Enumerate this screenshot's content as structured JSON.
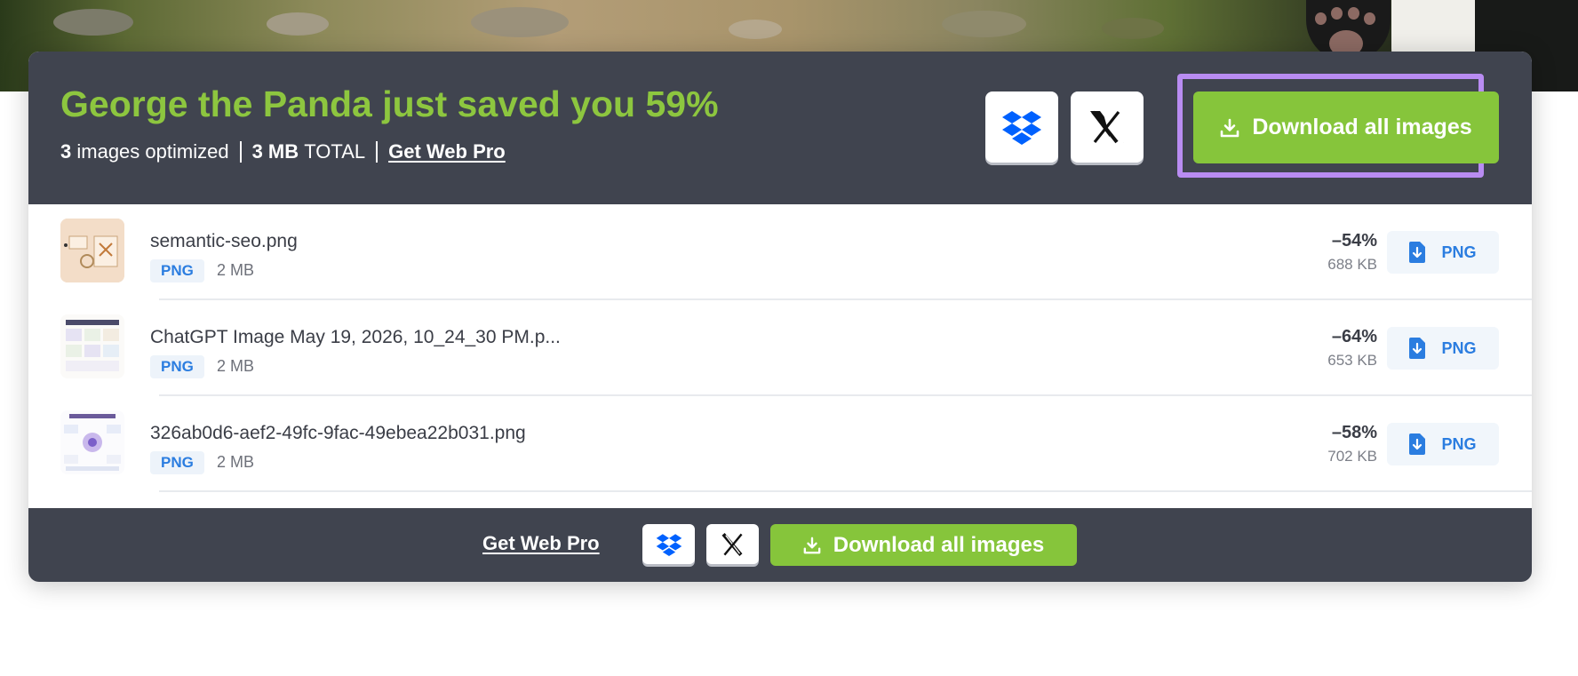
{
  "summary": {
    "title": "George the Panda just saved you 59%",
    "images_count": "3",
    "images_label": "images optimized",
    "total_value": "3 MB",
    "total_label": "TOTAL",
    "get_pro": "Get Web Pro",
    "download_all": "Download all images"
  },
  "files": [
    {
      "name": "semantic-seo.png",
      "type": "PNG",
      "original_size": "2 MB",
      "saving": "–54%",
      "new_size": "688 KB",
      "format_button": "PNG"
    },
    {
      "name": "ChatGPT Image May 19, 2026, 10_24_30 PM.p...",
      "type": "PNG",
      "original_size": "2 MB",
      "saving": "–64%",
      "new_size": "653 KB",
      "format_button": "PNG"
    },
    {
      "name": "326ab0d6-aef2-49fc-9fac-49ebea22b031.png",
      "type": "PNG",
      "original_size": "2 MB",
      "saving": "–58%",
      "new_size": "702 KB",
      "format_button": "PNG"
    }
  ],
  "footer": {
    "get_pro": "Get Web Pro",
    "download_all": "Download all images"
  },
  "icons": {
    "dropbox": "dropbox-icon",
    "x": "x-logo-icon",
    "download": "download-icon",
    "file_download": "file-download-icon"
  },
  "colors": {
    "accent_green": "#86c53b",
    "title_green": "#8dc63f",
    "panel_dark": "#40444f",
    "link_blue": "#2b7de0",
    "highlight": "#b98cf2",
    "dropbox_blue": "#0061fe"
  }
}
